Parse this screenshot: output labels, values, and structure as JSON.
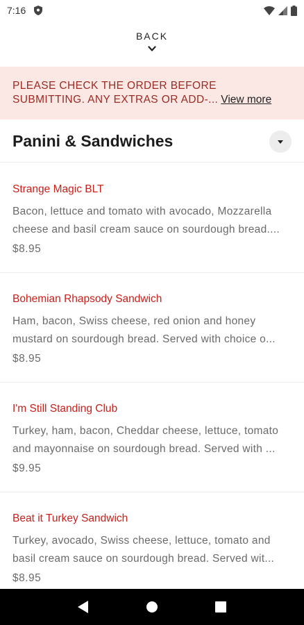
{
  "status_bar": {
    "time": "7:16",
    "icons": [
      "shield-icon",
      "wifi-icon",
      "signal-icon",
      "battery-icon"
    ]
  },
  "back": {
    "label": "BACK",
    "icon": "chevron-down-icon"
  },
  "notice": {
    "line1": "PLEASE CHECK THE ORDER BEFORE",
    "line2": "SUBMITTING. ANY EXTRAS OR ADD-...",
    "view_more": "View more",
    "background": "#fbe8e4",
    "text_color": "#9b2a23"
  },
  "section": {
    "title": "Panini & Sandwiches",
    "toggle_icon": "caret-down-icon"
  },
  "items": [
    {
      "name": "Strange Magic BLT",
      "desc_line1": "Bacon, lettuce and tomato with avocado, Mozzarella",
      "desc_line2": "cheese and basil cream sauce on sourdough bread....",
      "price": "$8.95"
    },
    {
      "name": "Bohemian Rhapsody Sandwich",
      "desc_line1": "Ham, bacon, Swiss cheese, red onion and honey",
      "desc_line2": "mustard on sourdough bread. Served with choice o...",
      "price": "$8.95"
    },
    {
      "name": "I'm Still Standing Club",
      "desc_line1": "Turkey, ham, bacon, Cheddar cheese, lettuce, tomato",
      "desc_line2": "and mayonnaise on sourdough bread. Served with ...",
      "price": "$9.95"
    },
    {
      "name": "Beat it Turkey Sandwich",
      "desc_line1": "Turkey, avocado, Swiss cheese, lettuce, tomato and",
      "desc_line2": "basil cream sauce on sourdough bread. Served wit...",
      "price": "$8.95"
    }
  ],
  "nav_bar": {
    "buttons": [
      "back-triangle-icon",
      "home-circle-icon",
      "recents-square-icon"
    ]
  },
  "colors": {
    "accent_red": "#c8201b",
    "muted_text": "#6a6a6a"
  }
}
